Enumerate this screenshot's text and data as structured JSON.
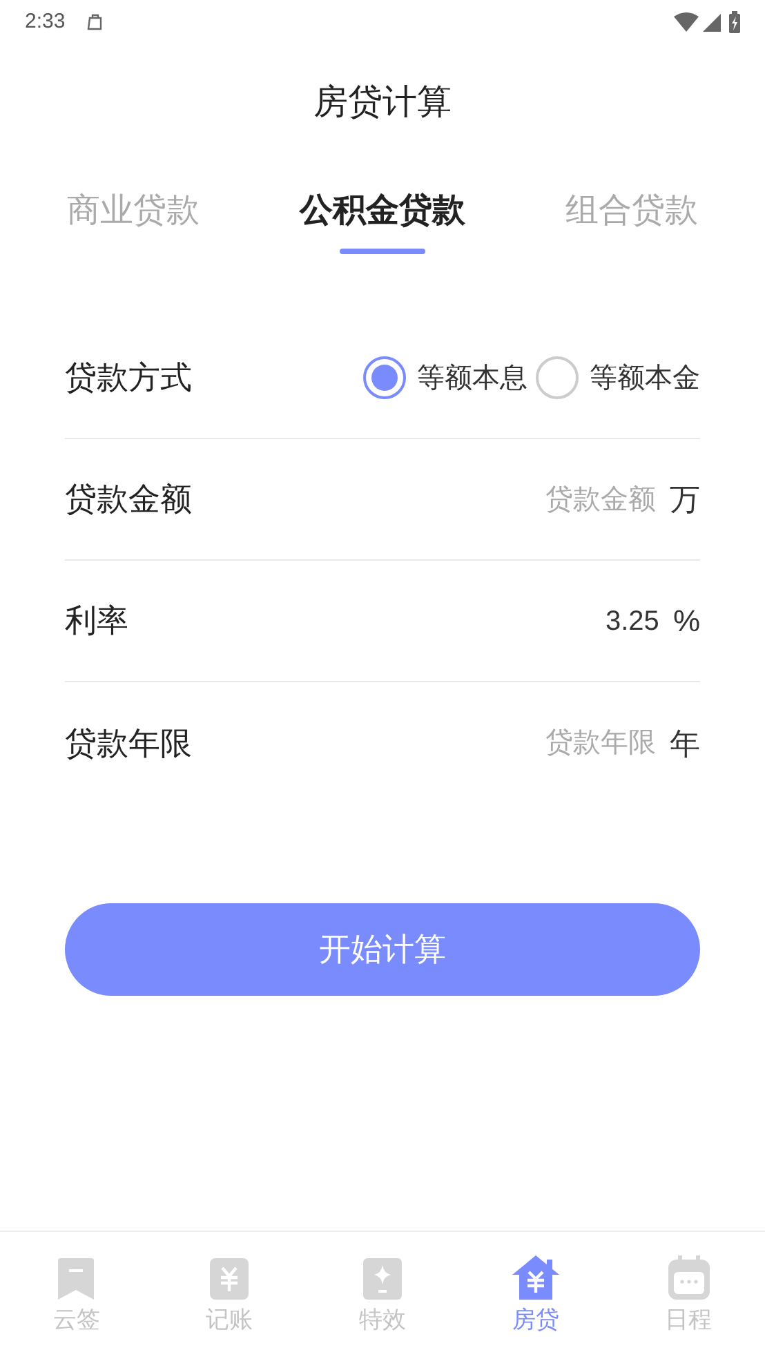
{
  "status_bar": {
    "time": "2:33"
  },
  "title": "房贷计算",
  "tabs": [
    {
      "label": "商业贷款",
      "selected": false
    },
    {
      "label": "公积金贷款",
      "selected": true
    },
    {
      "label": "组合贷款",
      "selected": false
    }
  ],
  "form": [
    {
      "kind": "radio",
      "label": "贷款方式",
      "options": [
        {
          "label": "等额本息",
          "selected": true
        },
        {
          "label": "等额本金",
          "selected": false
        }
      ]
    },
    {
      "kind": "input",
      "label": "贷款金额",
      "placeholder": "贷款金额",
      "unit": "万"
    },
    {
      "kind": "input",
      "label": "利率",
      "value": "3.25",
      "unit": "%"
    },
    {
      "kind": "input",
      "label": "贷款年限",
      "placeholder": "贷款年限",
      "unit": "年"
    }
  ],
  "button": "开始计算",
  "nav": [
    {
      "label": "云签",
      "selected": false
    },
    {
      "label": "记账",
      "selected": false
    },
    {
      "label": "特效",
      "selected": false
    },
    {
      "label": "房贷",
      "selected": true
    },
    {
      "label": "日程",
      "selected": false
    }
  ]
}
